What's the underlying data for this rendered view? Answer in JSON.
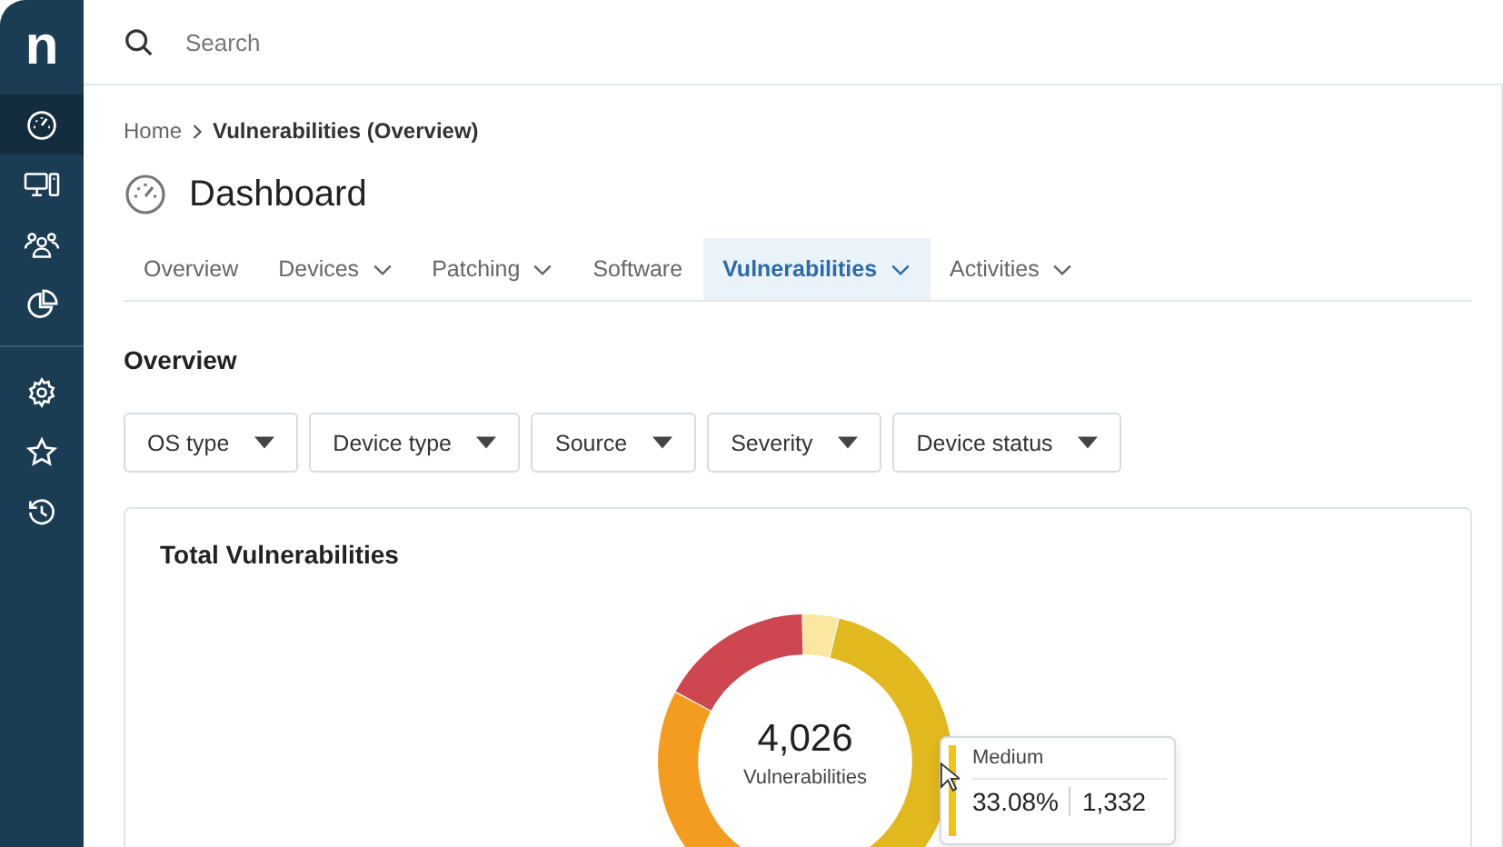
{
  "sidebar": {
    "logo": "n",
    "items": [
      {
        "kind": "dashboard",
        "selected": true
      },
      {
        "kind": "devices",
        "selected": false
      },
      {
        "kind": "users",
        "selected": false
      },
      {
        "kind": "reports",
        "selected": false
      },
      {
        "kind": "settings",
        "selected": false
      },
      {
        "kind": "favorites",
        "selected": false
      },
      {
        "kind": "history",
        "selected": false
      }
    ]
  },
  "search": {
    "placeholder": "Search"
  },
  "breadcrumb": {
    "home": "Home",
    "current": "Vulnerabilities (Overview)"
  },
  "page_title": "Dashboard",
  "tabs": [
    {
      "label": "Overview",
      "selected": false,
      "menu": false
    },
    {
      "label": "Devices",
      "selected": false,
      "menu": true
    },
    {
      "label": "Patching",
      "selected": false,
      "menu": true
    },
    {
      "label": "Software",
      "selected": false,
      "menu": false
    },
    {
      "label": "Vulnerabilities",
      "selected": true,
      "menu": true
    },
    {
      "label": "Activities",
      "selected": false,
      "menu": true
    }
  ],
  "section_title": "Overview",
  "filters": [
    "OS type",
    "Device type",
    "Source",
    "Severity",
    "Device status"
  ],
  "card": {
    "title": "Total Vulnerabilities",
    "total": "4,026",
    "total_label": "Vulnerabilities",
    "tooltip": {
      "label": "Medium",
      "color": "#f2c318",
      "percent": "33.08%",
      "count": "1,332"
    }
  }
}
